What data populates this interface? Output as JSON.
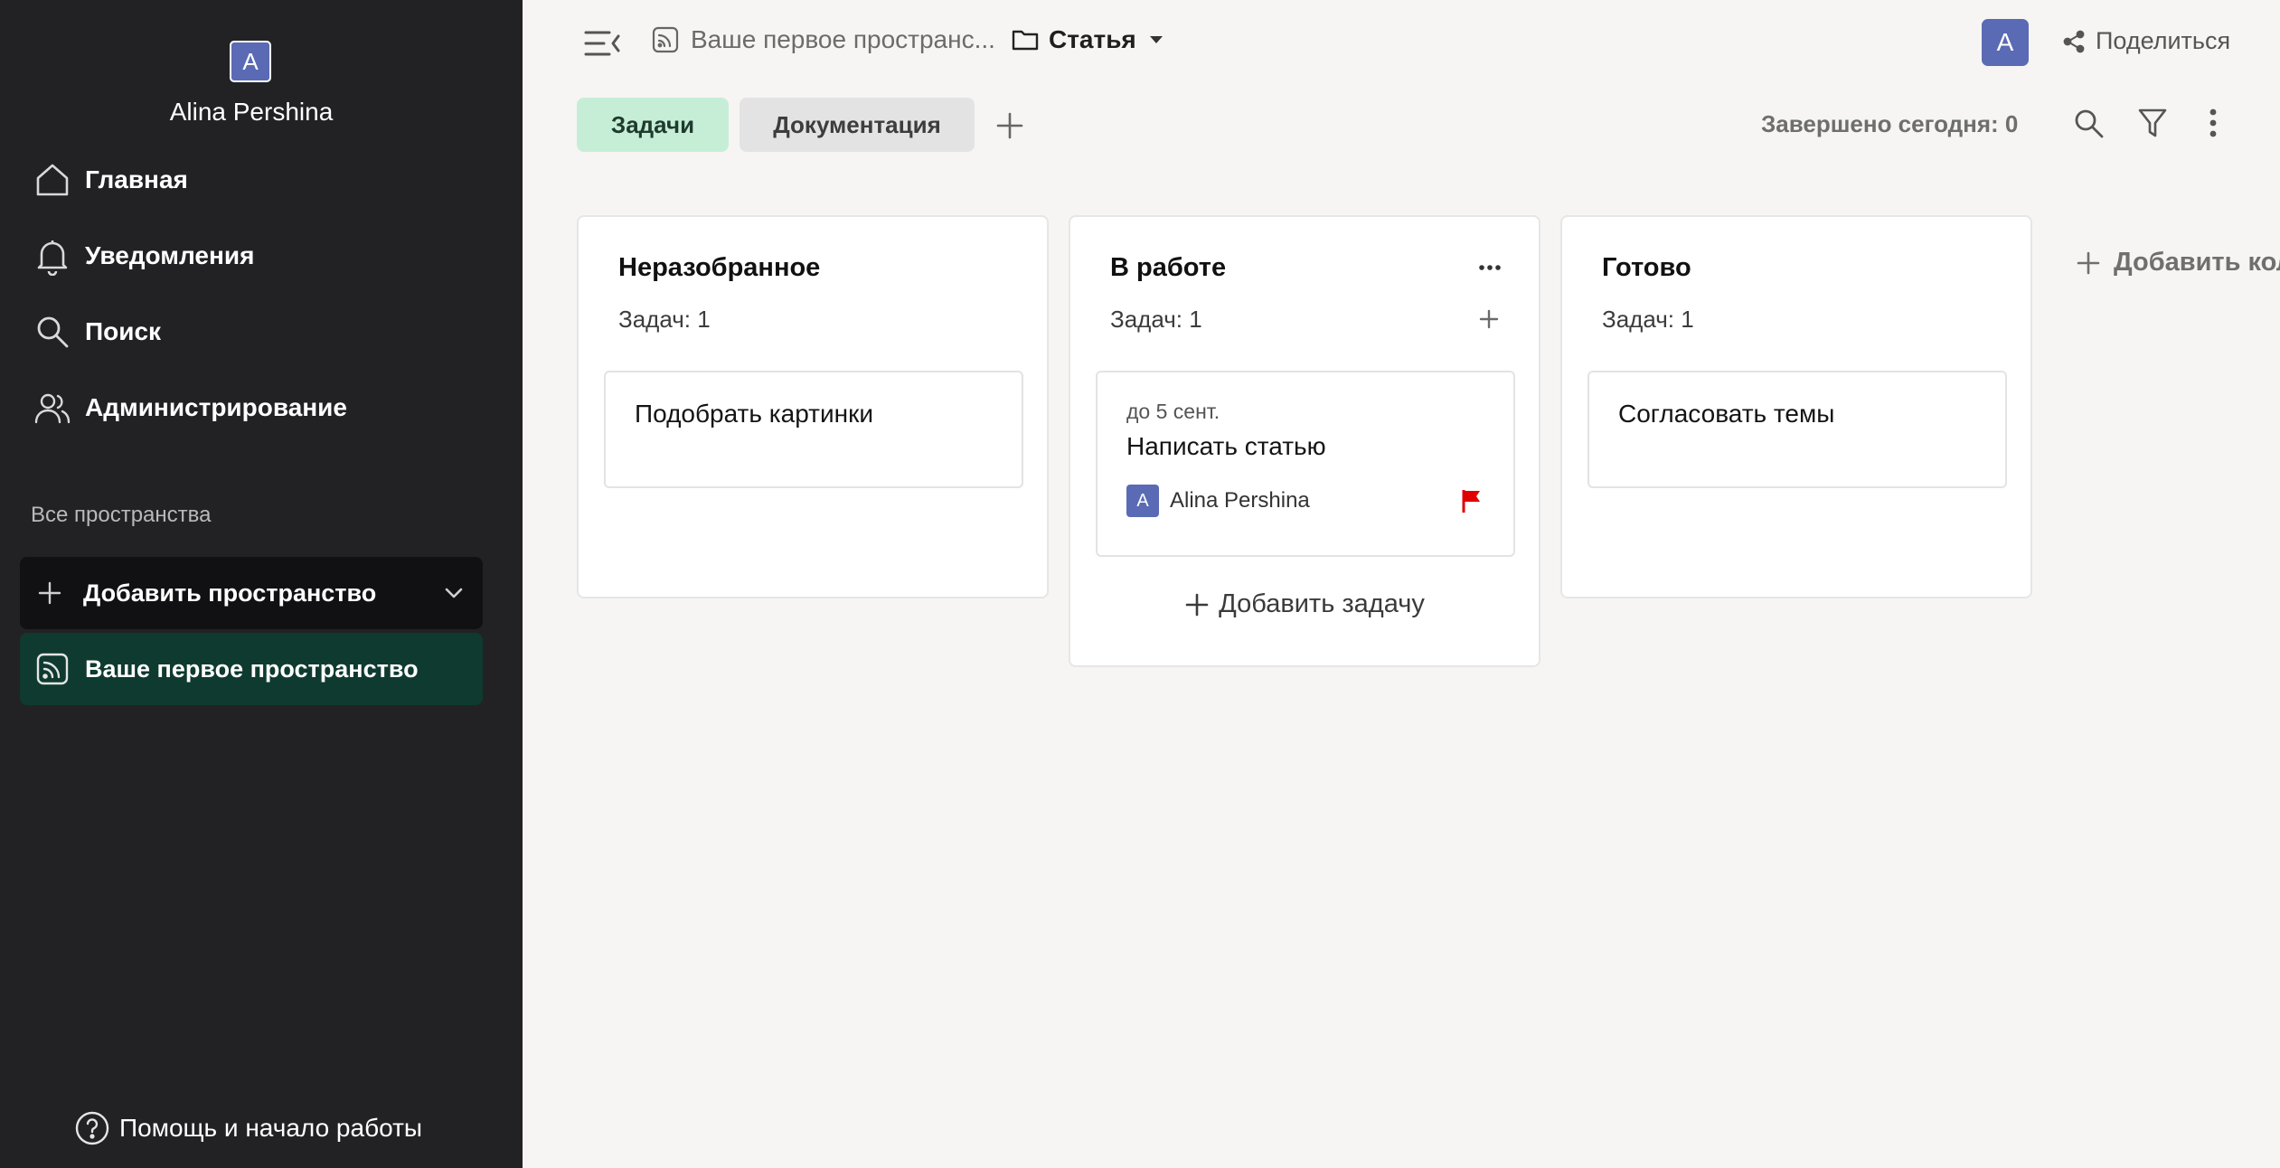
{
  "sidebar": {
    "user": {
      "initial": "A",
      "name": "Alina Pershina"
    },
    "nav": [
      {
        "label": "Главная",
        "icon": "home-icon"
      },
      {
        "label": "Уведомления",
        "icon": "bell-icon"
      },
      {
        "label": "Поиск",
        "icon": "search-icon"
      },
      {
        "label": "Администрирование",
        "icon": "users-icon"
      }
    ],
    "section_label": "Все пространства",
    "add_space_label": "Добавить пространство",
    "space_label": "Ваше первое пространство",
    "help_label": "Помощь и начало работы",
    "colors": {
      "background": "#222224",
      "active_space": "#0f3a2f"
    }
  },
  "header": {
    "breadcrumb_space": "Ваше первое пространс...",
    "breadcrumb_folder": "Статья",
    "avatar_initial": "A",
    "share_label": "Поделиться"
  },
  "tabs": [
    {
      "label": "Задачи",
      "active": true
    },
    {
      "label": "Документация",
      "active": false
    }
  ],
  "toolbar": {
    "completed_today": "Завершено сегодня: 0"
  },
  "board": {
    "columns": [
      {
        "title": "Неразобранное",
        "count": "Задач: 1",
        "cards": [
          {
            "title": "Подобрать картинки"
          }
        ]
      },
      {
        "title": "В работе",
        "count": "Задач: 1",
        "cards": [
          {
            "due": "до 5 сент.",
            "title": "Написать статью",
            "assignee_initial": "A",
            "assignee": "Alina Pershina",
            "flag_color": "#e00000"
          }
        ],
        "add_task_label": "Добавить задачу"
      },
      {
        "title": "Готово",
        "count": "Задач: 1",
        "cards": [
          {
            "title": "Согласовать темы"
          }
        ]
      }
    ],
    "add_column_label": "Добавить колонку"
  },
  "colors": {
    "accent": "#5a6ab4",
    "tab_active": "#c6eed7"
  }
}
